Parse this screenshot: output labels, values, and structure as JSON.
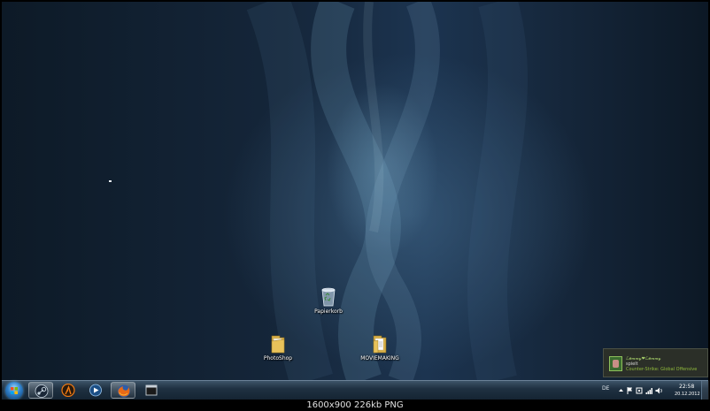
{
  "desktop": {
    "icons": [
      {
        "label": "Papierkorb",
        "icon": "recycle-bin-icon"
      },
      {
        "label": "PhotoShop",
        "icon": "folder-icon"
      },
      {
        "label": "MOVIEMAKING",
        "icon": "folder-icon"
      }
    ]
  },
  "notification": {
    "name": "ℒ𝑒𝓂𝓂𝓎❤ℒ𝑒𝓂𝓂𝓎",
    "status": "spielt",
    "game": "Counter-Strike: Global Offensive"
  },
  "taskbar": {
    "start_icon": "windows-start-orb",
    "apps": [
      {
        "icon": "steam-icon",
        "pinned": true
      },
      {
        "icon": "half-life-icon",
        "pinned": false
      },
      {
        "icon": "media-player-icon",
        "pinned": false
      },
      {
        "icon": "firefox-icon",
        "pinned": true
      },
      {
        "icon": "window-app-icon",
        "pinned": false
      }
    ],
    "tray": {
      "language": "DE",
      "time": "22:58",
      "date": "20.12.2012"
    }
  },
  "caption": "1600x900  226kb  PNG",
  "colors": {
    "desktop_dark": "#0d1a27",
    "desktop_light": "#3a6a8c",
    "taskbar": "#1f3142",
    "popup_bg": "#2b2f28",
    "steam_green": "#90ba3c"
  }
}
